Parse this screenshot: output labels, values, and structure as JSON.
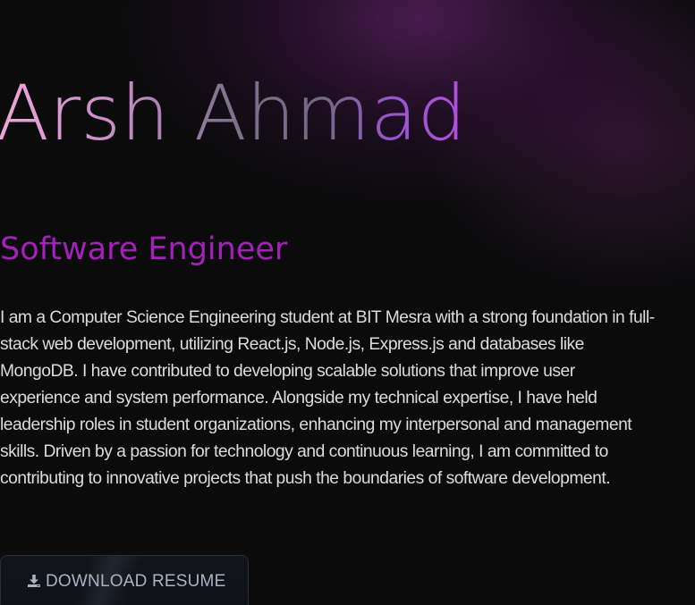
{
  "hero": {
    "name": "Arsh Ahmad",
    "role": "Software Engineer",
    "bio": "I am a Computer Science Engineering student at BIT Mesra with a strong foundation in full-stack web development, utilizing React.js, Node.js, Express.js and databases like MongoDB. I have contributed to developing scalable solutions that improve user experience and system performance. Alongside my technical expertise, I have held leadership roles in student organizations, enhancing my interpersonal and management skills. Driven by a passion for technology and continuous learning, I am committed to contributing to innovative projects that push the boundaries of software development.",
    "resume_button": {
      "icon": "download-icon",
      "label": "DOWNLOAD RESUME"
    }
  },
  "colors": {
    "background": "#0b0b0c",
    "role_text": "#a321b8",
    "bio_text": "#dcdcdc",
    "button_text": "#aab2c4",
    "name_gradient": [
      "#f0a6d8",
      "#7e728e",
      "#b54ee0"
    ]
  }
}
